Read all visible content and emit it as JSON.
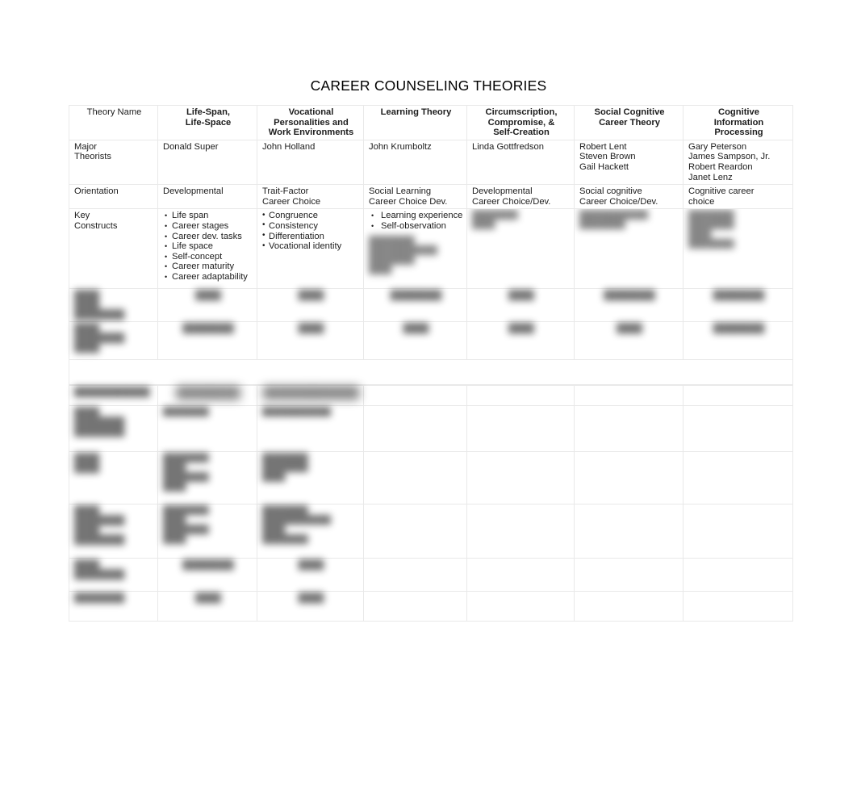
{
  "document": {
    "title": "CAREER COUNSELING THEORIES"
  },
  "table": {
    "row_label_header": "Theory Name",
    "column_headers": [
      "Life-Span, Life-Space",
      "Vocational Personalities and Work Environments",
      "Learning Theory",
      "Circumscription, Compromise, & Self-Creation",
      "Social Cognitive Career Theory",
      "Cognitive Information Processing"
    ],
    "column_headers_lines": [
      [
        "Life-Span,",
        "Life-Space"
      ],
      [
        "Vocational",
        "Personalities and",
        "Work Environments"
      ],
      [
        "Learning Theory"
      ],
      [
        "Circumscription,",
        "Compromise, &",
        "Self-Creation"
      ],
      [
        "Social Cognitive",
        "Career Theory"
      ],
      [
        "Cognitive",
        "Information",
        "Processing"
      ]
    ],
    "rows": [
      {
        "label": "Major Theorists",
        "label_lines": [
          "Major",
          "Theorists"
        ],
        "cells": [
          [
            "Donald Super"
          ],
          [
            "John Holland"
          ],
          [
            "John Krumboltz"
          ],
          [
            "Linda Gottfredson"
          ],
          [
            "Robert Lent",
            "Steven Brown",
            "Gail Hackett"
          ],
          [
            "Gary Peterson",
            "James Sampson, Jr.",
            "Robert Reardon",
            "Janet Lenz"
          ]
        ]
      },
      {
        "label": "Orientation",
        "label_lines": [
          "Orientation"
        ],
        "cells": [
          [
            "Developmental"
          ],
          [
            "Trait-Factor",
            "Career Choice"
          ],
          [
            "Social Learning",
            "Career Choice Dev."
          ],
          [
            "Developmental",
            "Career Choice/Dev."
          ],
          [
            "Social cognitive",
            "Career Choice/Dev."
          ],
          [
            "Cognitive career",
            "choice"
          ]
        ]
      },
      {
        "label": "Key Constructs",
        "label_lines": [
          "Key",
          "Constructs"
        ],
        "cells": [
          [
            "Life span",
            "Career stages",
            "Career dev. tasks",
            "Life space",
            "Self-concept",
            "Career maturity",
            "Career adaptability"
          ],
          [
            "Congruence",
            "Consistency",
            "Differentiation",
            "Vocational identity"
          ],
          [
            "Learning experience",
            "Self-observation"
          ],
          [],
          [],
          []
        ]
      }
    ]
  },
  "redacted": {
    "note_visible_text": "",
    "placeholder_short": "████",
    "placeholder_medium": "████████",
    "placeholder_long": "████████████"
  }
}
